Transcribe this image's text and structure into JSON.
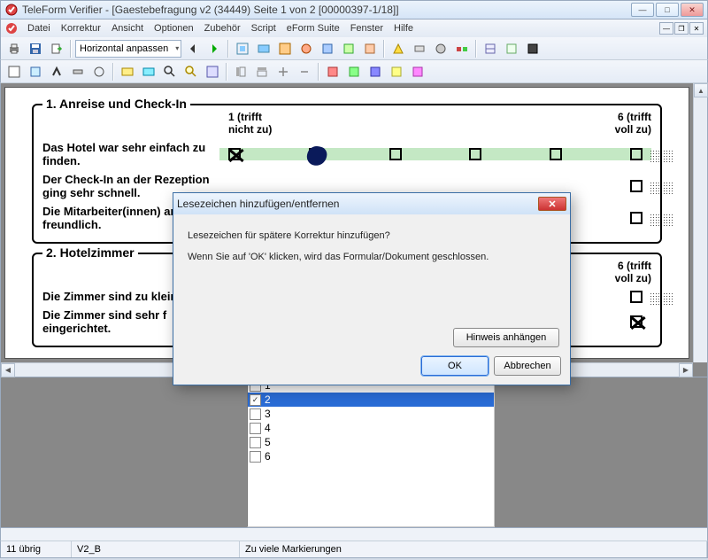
{
  "window": {
    "title": "TeleForm Verifier - [Gaestebefragung v2 (34449) Seite 1 von 2 [00000397-1/18]]"
  },
  "menu": {
    "items": [
      "Datei",
      "Korrektur",
      "Ansicht",
      "Optionen",
      "Zubehör",
      "Script",
      "eForm Suite",
      "Fenster",
      "Hilfe"
    ]
  },
  "toolbar1": {
    "zoom_mode": "Horizontal anpassen"
  },
  "form": {
    "section1": {
      "title": "1. Anreise und Check-In",
      "scale_left": "1 (trifft nicht zu)",
      "scale_right": "6 (trifft voll zu)",
      "q1": "Das Hotel war sehr einfach zu finden.",
      "q2": "Der Check-In an der Rezeption ging sehr schnell.",
      "q3": "Die Mitarbeiter(innen) and freundlich."
    },
    "section2": {
      "title": "2. Hotelzimmer",
      "scale_right": "6 (trifft voll zu)",
      "q1": "Die Zimmer sind zu klein.",
      "q2": "Die Zimmer sind sehr f eingerichtet."
    }
  },
  "list": {
    "items": [
      {
        "label": "1",
        "checked": false,
        "selected": false
      },
      {
        "label": "2",
        "checked": true,
        "selected": true
      },
      {
        "label": "3",
        "checked": false,
        "selected": false
      },
      {
        "label": "4",
        "checked": false,
        "selected": false
      },
      {
        "label": "5",
        "checked": false,
        "selected": false
      },
      {
        "label": "6",
        "checked": false,
        "selected": false
      }
    ]
  },
  "status": {
    "remaining": "11 übrig",
    "field": "V2_B",
    "msg": "Zu viele Markierungen"
  },
  "dialog": {
    "title": "Lesezeichen hinzufügen/entfernen",
    "line1": "Lesezeichen für spätere Korrektur hinzufügen?",
    "line2": "Wenn Sie auf 'OK' klicken, wird das Formular/Dokument geschlossen.",
    "attach": "Hinweis anhängen",
    "ok": "OK",
    "cancel": "Abbrechen"
  }
}
